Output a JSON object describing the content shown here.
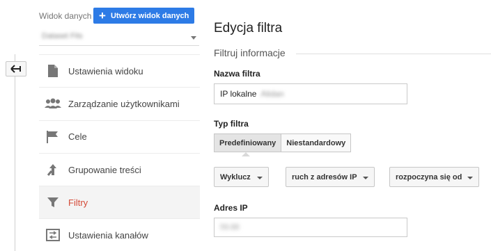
{
  "sidebar": {
    "view_label": "Widok danych",
    "create_view_button": "Utwórz widok danych",
    "view_select_value": "Dataset Fits",
    "items": [
      {
        "label": "Ustawienia widoku",
        "icon": "document-icon"
      },
      {
        "label": "Zarządzanie użytkownikami",
        "icon": "users-icon"
      },
      {
        "label": "Cele",
        "icon": "flag-icon"
      },
      {
        "label": "Grupowanie treści",
        "icon": "merge-arrow-icon"
      },
      {
        "label": "Filtry",
        "icon": "filter-icon",
        "active": true
      },
      {
        "label": "Ustawienia kanałów",
        "icon": "channel-settings-icon"
      }
    ]
  },
  "main": {
    "title": "Edycja filtra",
    "section_title": "Filtruj informacje",
    "filter_name_label": "Nazwa filtra",
    "filter_name_value": "IP lokalne",
    "filter_name_hidden": "Alidan",
    "filter_type_label": "Typ filtra",
    "type_tabs": [
      "Predefiniowany",
      "Niestandardowy"
    ],
    "selected_type": "Predefiniowany",
    "dropdowns": [
      "Wyklucz",
      "ruch z adresów IP",
      "rozpoczyna się od"
    ],
    "ip_label": "Adres IP",
    "ip_value": "59.88"
  },
  "colors": {
    "accent_blue": "#2d7be6",
    "active_red": "#d44b38"
  }
}
